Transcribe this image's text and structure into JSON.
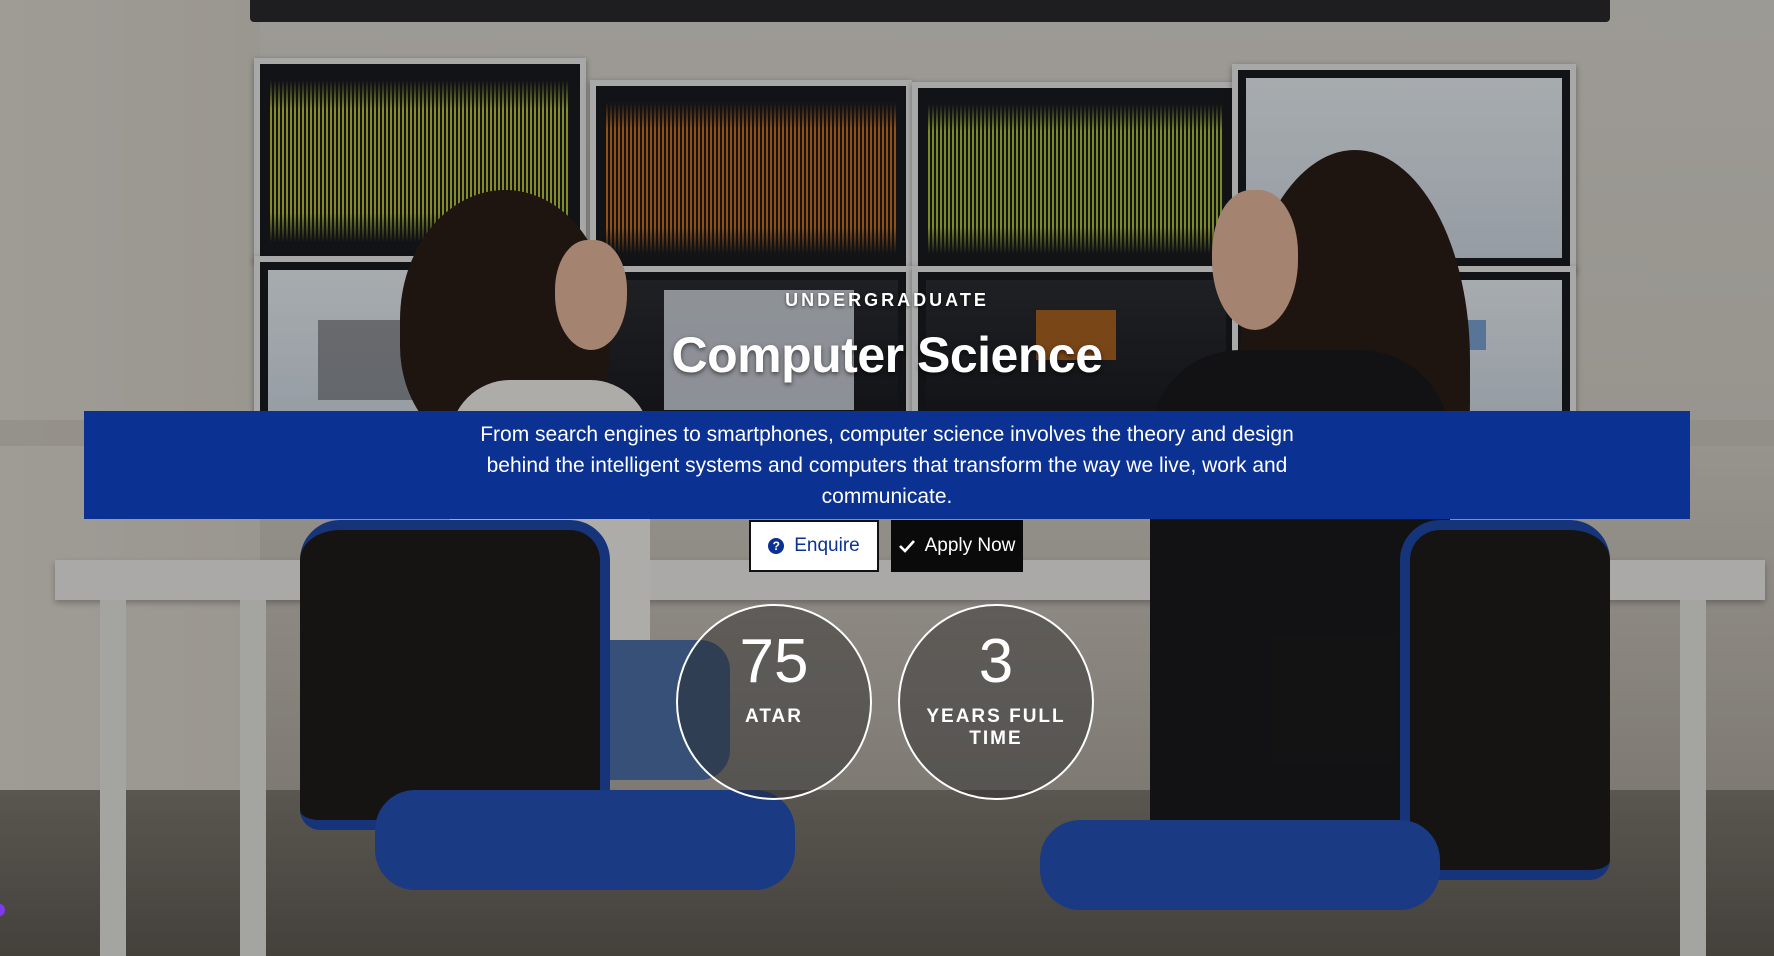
{
  "hero": {
    "eyebrow": "UNDERGRADUATE",
    "title": "Computer Science",
    "description": "From search engines to smartphones, computer science involves the theory and design behind the intelligent systems and computers that transform the way we live, work and communicate.",
    "background_image": "two-students-at-desk-in-front-of-monitor-wall"
  },
  "actions": {
    "enquire_label": "Enquire",
    "enquire_icon": "question-circle-icon",
    "apply_label": "Apply Now",
    "apply_icon": "check-icon"
  },
  "stats": [
    {
      "value": "75",
      "label": "ATAR"
    },
    {
      "value": "3",
      "label": "YEARS FULL TIME"
    }
  ],
  "colors": {
    "band_blue": "#0b3193",
    "apply_bg": "#0a0a0a",
    "enquire_bg": "#ffffff",
    "text_light": "#ffffff"
  }
}
